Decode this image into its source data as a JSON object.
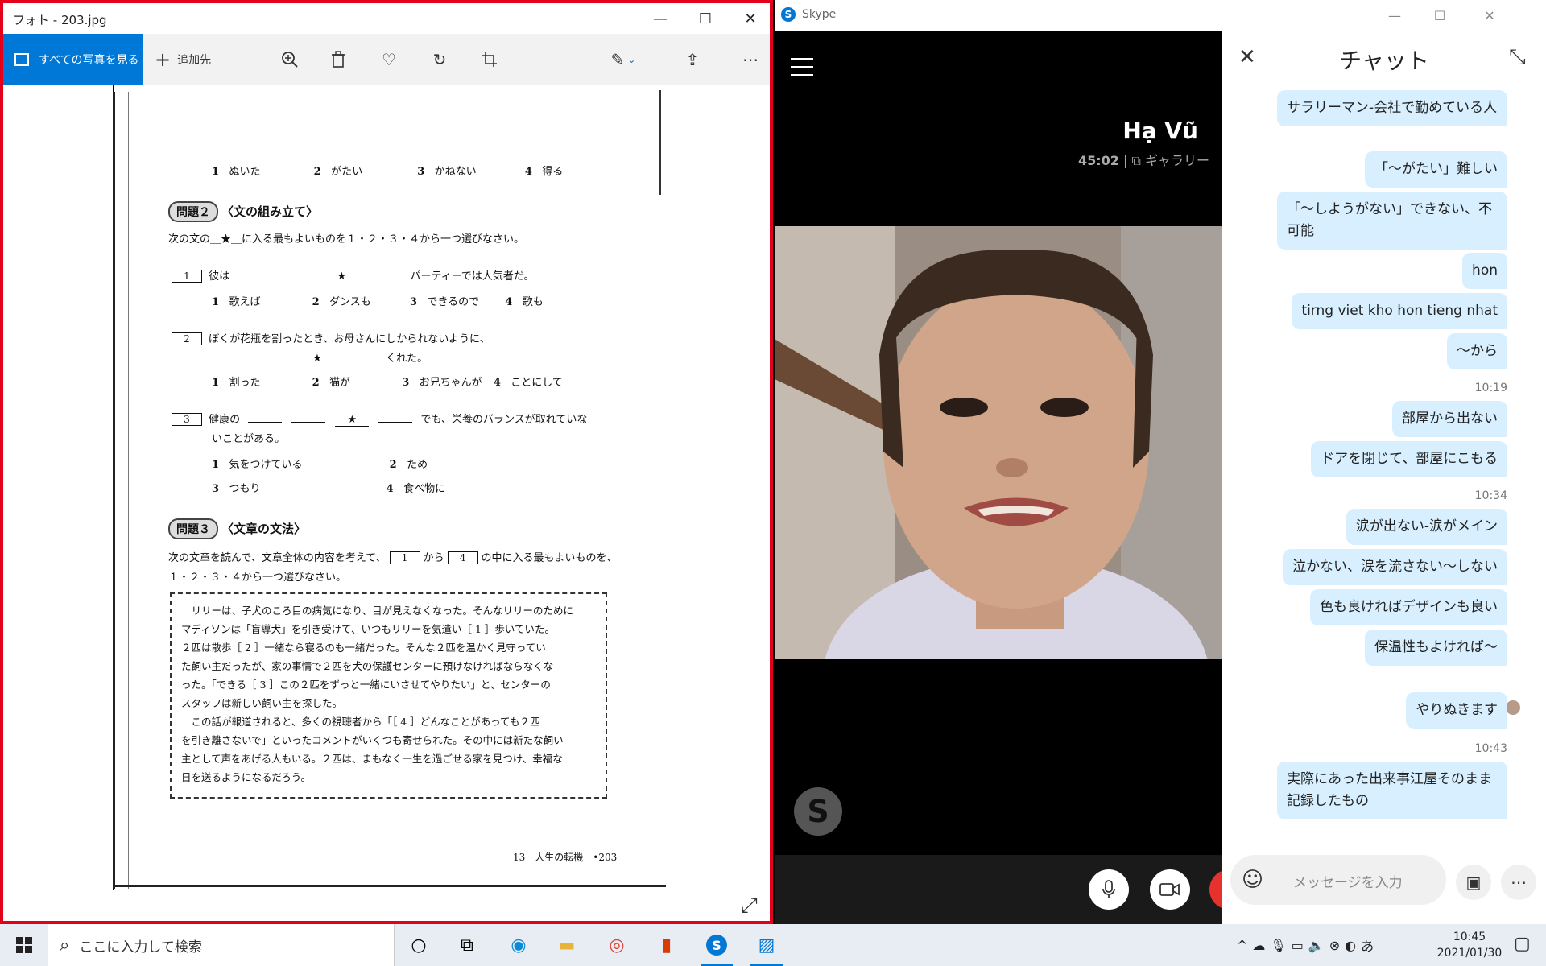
{
  "photos": {
    "title": "フォト - 203.jpg",
    "all_photos_label": "すべての写真を見る",
    "add_to_label": "追加先",
    "doc": {
      "row0": {
        "o1": "1",
        "t1": "ぬいた",
        "o2": "2",
        "t2": "がたい",
        "o3": "3",
        "t3": "かねない",
        "o4": "4",
        "t4": "得る"
      },
      "mondai2_num": "問題２",
      "mondai2_title": "〈文の組み立て〉",
      "instr2": "次の文の＿★＿に入る最もよいものを１・２・３・４から一つ選びなさい。",
      "q1": {
        "num": "1",
        "lead": "彼は",
        "star": "★",
        "tail": "パーティーでは人気者だ。",
        "o1": "1",
        "t1": "歌えば",
        "o2": "2",
        "t2": "ダンスも",
        "o3": "3",
        "t3": "できるので",
        "o4": "4",
        "t4": "歌も"
      },
      "q2": {
        "num": "2",
        "lead": "ぼくが花瓶を割ったとき、お母さんにしかられないように、",
        "star": "★",
        "tail": "くれた。",
        "o1": "1",
        "t1": "割った",
        "o2": "2",
        "t2": "猫が",
        "o3": "3",
        "t3": "お兄ちゃんが",
        "o4": "4",
        "t4": "ことにして"
      },
      "q3": {
        "num": "3",
        "lead": "健康の",
        "star": "★",
        "tail": "でも、栄養のバランスが取れていな",
        "tail2": "いことがある。",
        "o1": "1",
        "t1": "気をつけている",
        "o2": "2",
        "t2": "ため",
        "o3": "3",
        "t3": "つもり",
        "o4": "4",
        "t4": "食べ物に"
      },
      "mondai3_num": "問題３",
      "mondai3_title": "〈文章の文法〉",
      "instr3a": "次の文章を読んで、文章全体の内容を考えて、",
      "instr3b_box1": "1",
      "instr3b_mid": "から",
      "instr3b_box2": "4",
      "instr3c": "の中に入る最もよいものを、",
      "instr3d": "１・２・３・４から一つ選びなさい。",
      "passage": [
        "　リリーは、子犬のころ目の病気になり、目が見えなくなった。そんなリリーのために",
        "マディソンは「盲導犬」を引き受けて、いつもリリーを気遣い［ 1 ］歩いていた。",
        "２匹は散歩［ 2 ］一緒なら寝るのも一緒だった。そんな２匹を温かく見守ってい",
        "た飼い主だったが、家の事情で２匹を犬の保護センターに預けなければならなくな",
        "った。「できる［ 3 ］この２匹をずっと一緒にいさせてやりたい」と、センターの",
        "スタッフは新しい飼い主を探した。",
        "　この話が報道されると、多くの視聴者から「［ 4 ］どんなことがあっても２匹",
        "を引き離さないで」といったコメントがいくつも寄せられた。その中には新たな飼い",
        "主として声をあげる人もいる。２匹は、まもなく一生を過ごせる家を見つけ、幸福な",
        "日を送るようになるだろう。"
      ],
      "footer": "13　人生の転機　•203"
    }
  },
  "skype": {
    "title": "Skype",
    "contact_name": "Hạ Vũ",
    "call_duration": "45:02",
    "view_mode": "ギャラリー",
    "chat_title": "チャット",
    "compose_placeholder": "メッセージを入力",
    "messages": [
      {
        "text": "サラリーマン-会社で勤めている人"
      },
      {
        "text": "「～がたい」難しい"
      },
      {
        "text": "「～しようがない」できない、不可能"
      },
      {
        "text": "hon"
      },
      {
        "text": "tirng viet kho hon tieng nhat"
      },
      {
        "text": "～から"
      },
      {
        "time": "10:19"
      },
      {
        "text": "部屋から出ない"
      },
      {
        "text": "ドアを閉じて、部屋にこもる"
      },
      {
        "time": "10:34"
      },
      {
        "text": "涙が出ない-涙がメイン"
      },
      {
        "text": "泣かない、涙を流さない～しない"
      },
      {
        "text": "色も良ければデザインも良い"
      },
      {
        "text": "保温性もよければ～"
      },
      {
        "text": "やりぬきます"
      },
      {
        "time": "10:43"
      },
      {
        "text": "実際にあった出来事江屋そのまま記録したもの"
      }
    ]
  },
  "taskbar": {
    "search_placeholder": "ここに入力して検索",
    "time": "10:45",
    "date": "2021/01/30"
  },
  "colors": {
    "accent": "#0078d7",
    "photos_border": "#e3001b",
    "chat_bubble": "#d7efff",
    "end_call": "#e5322d"
  }
}
